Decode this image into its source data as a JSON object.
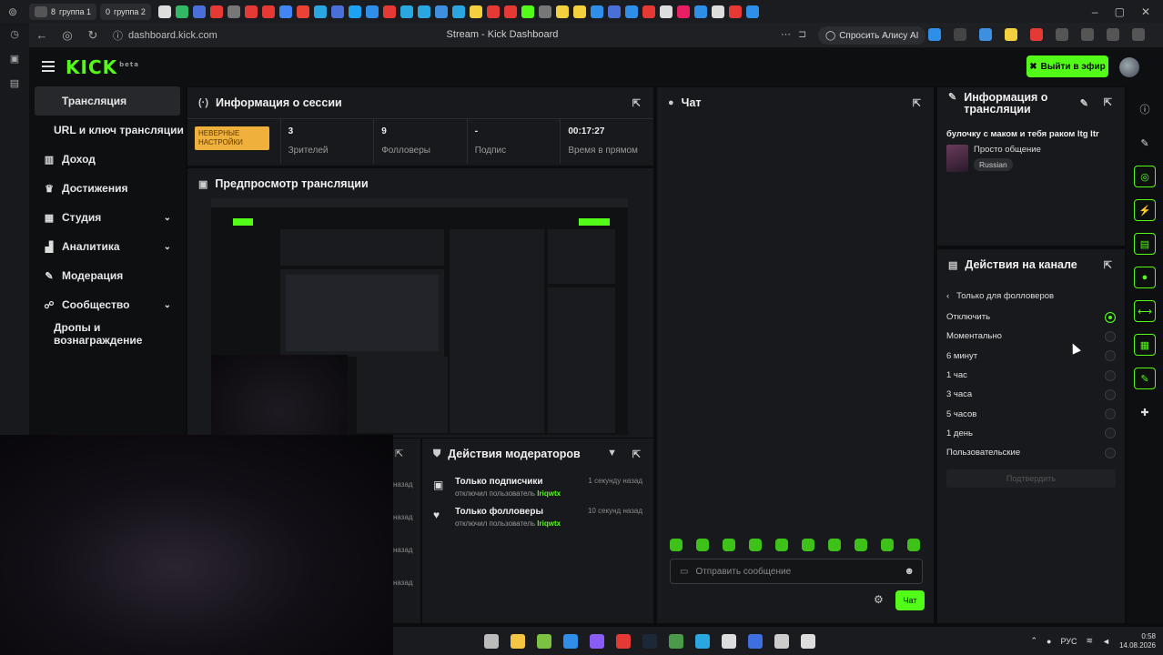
{
  "browser": {
    "tab_groups": [
      {
        "label": "группа 1",
        "count": "8"
      },
      {
        "label": "группа 2",
        "count": "0"
      }
    ],
    "url": "dashboard.kick.com",
    "page_title": "Stream - Kick Dashboard",
    "alice_label": "Спросить Алису AI"
  },
  "header": {
    "logo": "KICK",
    "logo_badge": "beta",
    "go_live_label": "Выйти в эфир"
  },
  "nav": {
    "items": [
      {
        "label": "Трансляция",
        "icon": "broadcast-icon"
      },
      {
        "label": "URL и ключ трансляции",
        "icon": ""
      },
      {
        "label": "Доход",
        "icon": "chart-icon"
      },
      {
        "label": "Достижения",
        "icon": "trophy-icon"
      },
      {
        "label": "Студия",
        "icon": "studio-icon"
      },
      {
        "label": "Аналитика",
        "icon": "analytics-icon"
      },
      {
        "label": "Модерация",
        "icon": "wrench-icon"
      },
      {
        "label": "Сообщество",
        "icon": "community-icon"
      },
      {
        "label": "Дропы и вознаграждение",
        "icon": ""
      }
    ]
  },
  "session": {
    "title": "Информация о сессии",
    "badge": "НЕВЕРНЫЕ НАСТРОЙКИ",
    "stats": [
      {
        "value": "3",
        "label": "Зрителей"
      },
      {
        "value": "9",
        "label": "Фолловеры"
      },
      {
        "value": "-",
        "label": "Подпис"
      },
      {
        "value": "00:17:27",
        "label": "Время в прямом"
      }
    ]
  },
  "preview": {
    "title": "Предпросмотр трансляции"
  },
  "mod_actions": {
    "title": "Действия модераторов",
    "rows": [
      {
        "title": "Только подписчики",
        "sub": "отключил пользователь",
        "user": "Iriqwtx",
        "time": "1 секунду назад"
      },
      {
        "title": "Только фолловеры",
        "sub": "отключил пользователь",
        "user": "Iriqwtx",
        "time": "10 секунд назад"
      }
    ],
    "left_times": [
      "назад",
      "назад",
      "назад",
      "назад"
    ]
  },
  "chat": {
    "title": "Чат",
    "placeholder": "Отправить сообщение",
    "send_label": "Чат"
  },
  "stream_info": {
    "title": "Информация о трансляции",
    "stream_title": "булочку с маком и тебя раком ltg ltr",
    "category": "Просто общение",
    "language": "Russian"
  },
  "channel_actions": {
    "title": "Действия на канале",
    "back_label": "Только для фолловеров",
    "options": [
      "Отключить",
      "Моментально",
      "6 минут",
      "1 час",
      "3 часа",
      "5 часов",
      "1 день",
      "Пользовательские"
    ],
    "selected": 0,
    "confirm_label": "Подтвердить"
  },
  "taskbar": {
    "lang": "РУС",
    "time": "0:58",
    "date": "14.08.2026"
  },
  "colors": {
    "accent": "#53fc18",
    "panel": "#18191c",
    "warn": "#f0b03c"
  }
}
